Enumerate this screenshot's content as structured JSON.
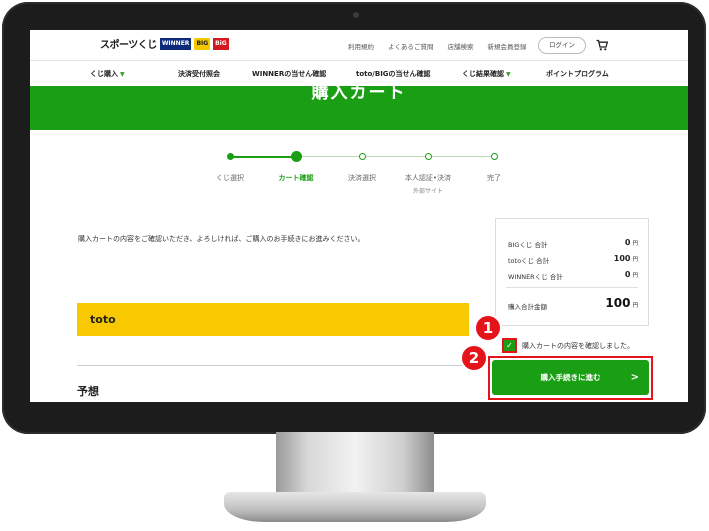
{
  "header": {
    "logo_text": "スポーツくじ",
    "logo_badges": [
      "WINNER",
      "BIG",
      "BiG"
    ],
    "links": [
      "利用規約",
      "よくあるご質問",
      "店舗検索",
      "新規会員登録"
    ],
    "login_label": "ログイン",
    "cart_icon": "cart-icon"
  },
  "nav": {
    "items": [
      {
        "label": "くじ購入",
        "dropdown": true
      },
      {
        "label": "決済受付照会",
        "dropdown": false
      },
      {
        "label": "WINNERの当せん確認",
        "dropdown": false
      },
      {
        "label": "toto/BIGの当せん確認",
        "dropdown": false
      },
      {
        "label": "くじ結果確認",
        "dropdown": true
      },
      {
        "label": "ポイントプログラム",
        "dropdown": false
      }
    ]
  },
  "banner": {
    "title": "購入カート"
  },
  "steps": [
    {
      "label": "くじ選択",
      "state": "done",
      "sub": ""
    },
    {
      "label": "カート確認",
      "state": "current",
      "sub": ""
    },
    {
      "label": "決済選択",
      "state": "todo",
      "sub": ""
    },
    {
      "label": "本人認証•決済",
      "state": "todo",
      "sub": "外部サイト"
    },
    {
      "label": "完了",
      "state": "todo",
      "sub": ""
    }
  ],
  "instruction": "購入カートの内容をご確認いただき、よろしければ、ご購入のお手続きにお進みください。",
  "summary": {
    "rows": [
      {
        "label": "BIGくじ 合計",
        "value": "0",
        "unit": "円"
      },
      {
        "label": "totoくじ 合計",
        "value": "100",
        "unit": "円"
      },
      {
        "label": "WINNERくじ 合計",
        "value": "0",
        "unit": "円"
      }
    ],
    "total_label": "購入合計金額",
    "total_value": "100",
    "total_unit": "円"
  },
  "toto_section": {
    "label": "toto"
  },
  "confirm": {
    "checked": true,
    "label": "購入カートの内容を確認しました。"
  },
  "proceed": {
    "label": "購入手続きに進む",
    "arrow": ">"
  },
  "markers": [
    "1",
    "2"
  ],
  "yosou_label": "予想",
  "colors": {
    "brand_green": "#1a9f14",
    "toto_yellow": "#f8c800",
    "highlight_red": "#e5141b"
  }
}
